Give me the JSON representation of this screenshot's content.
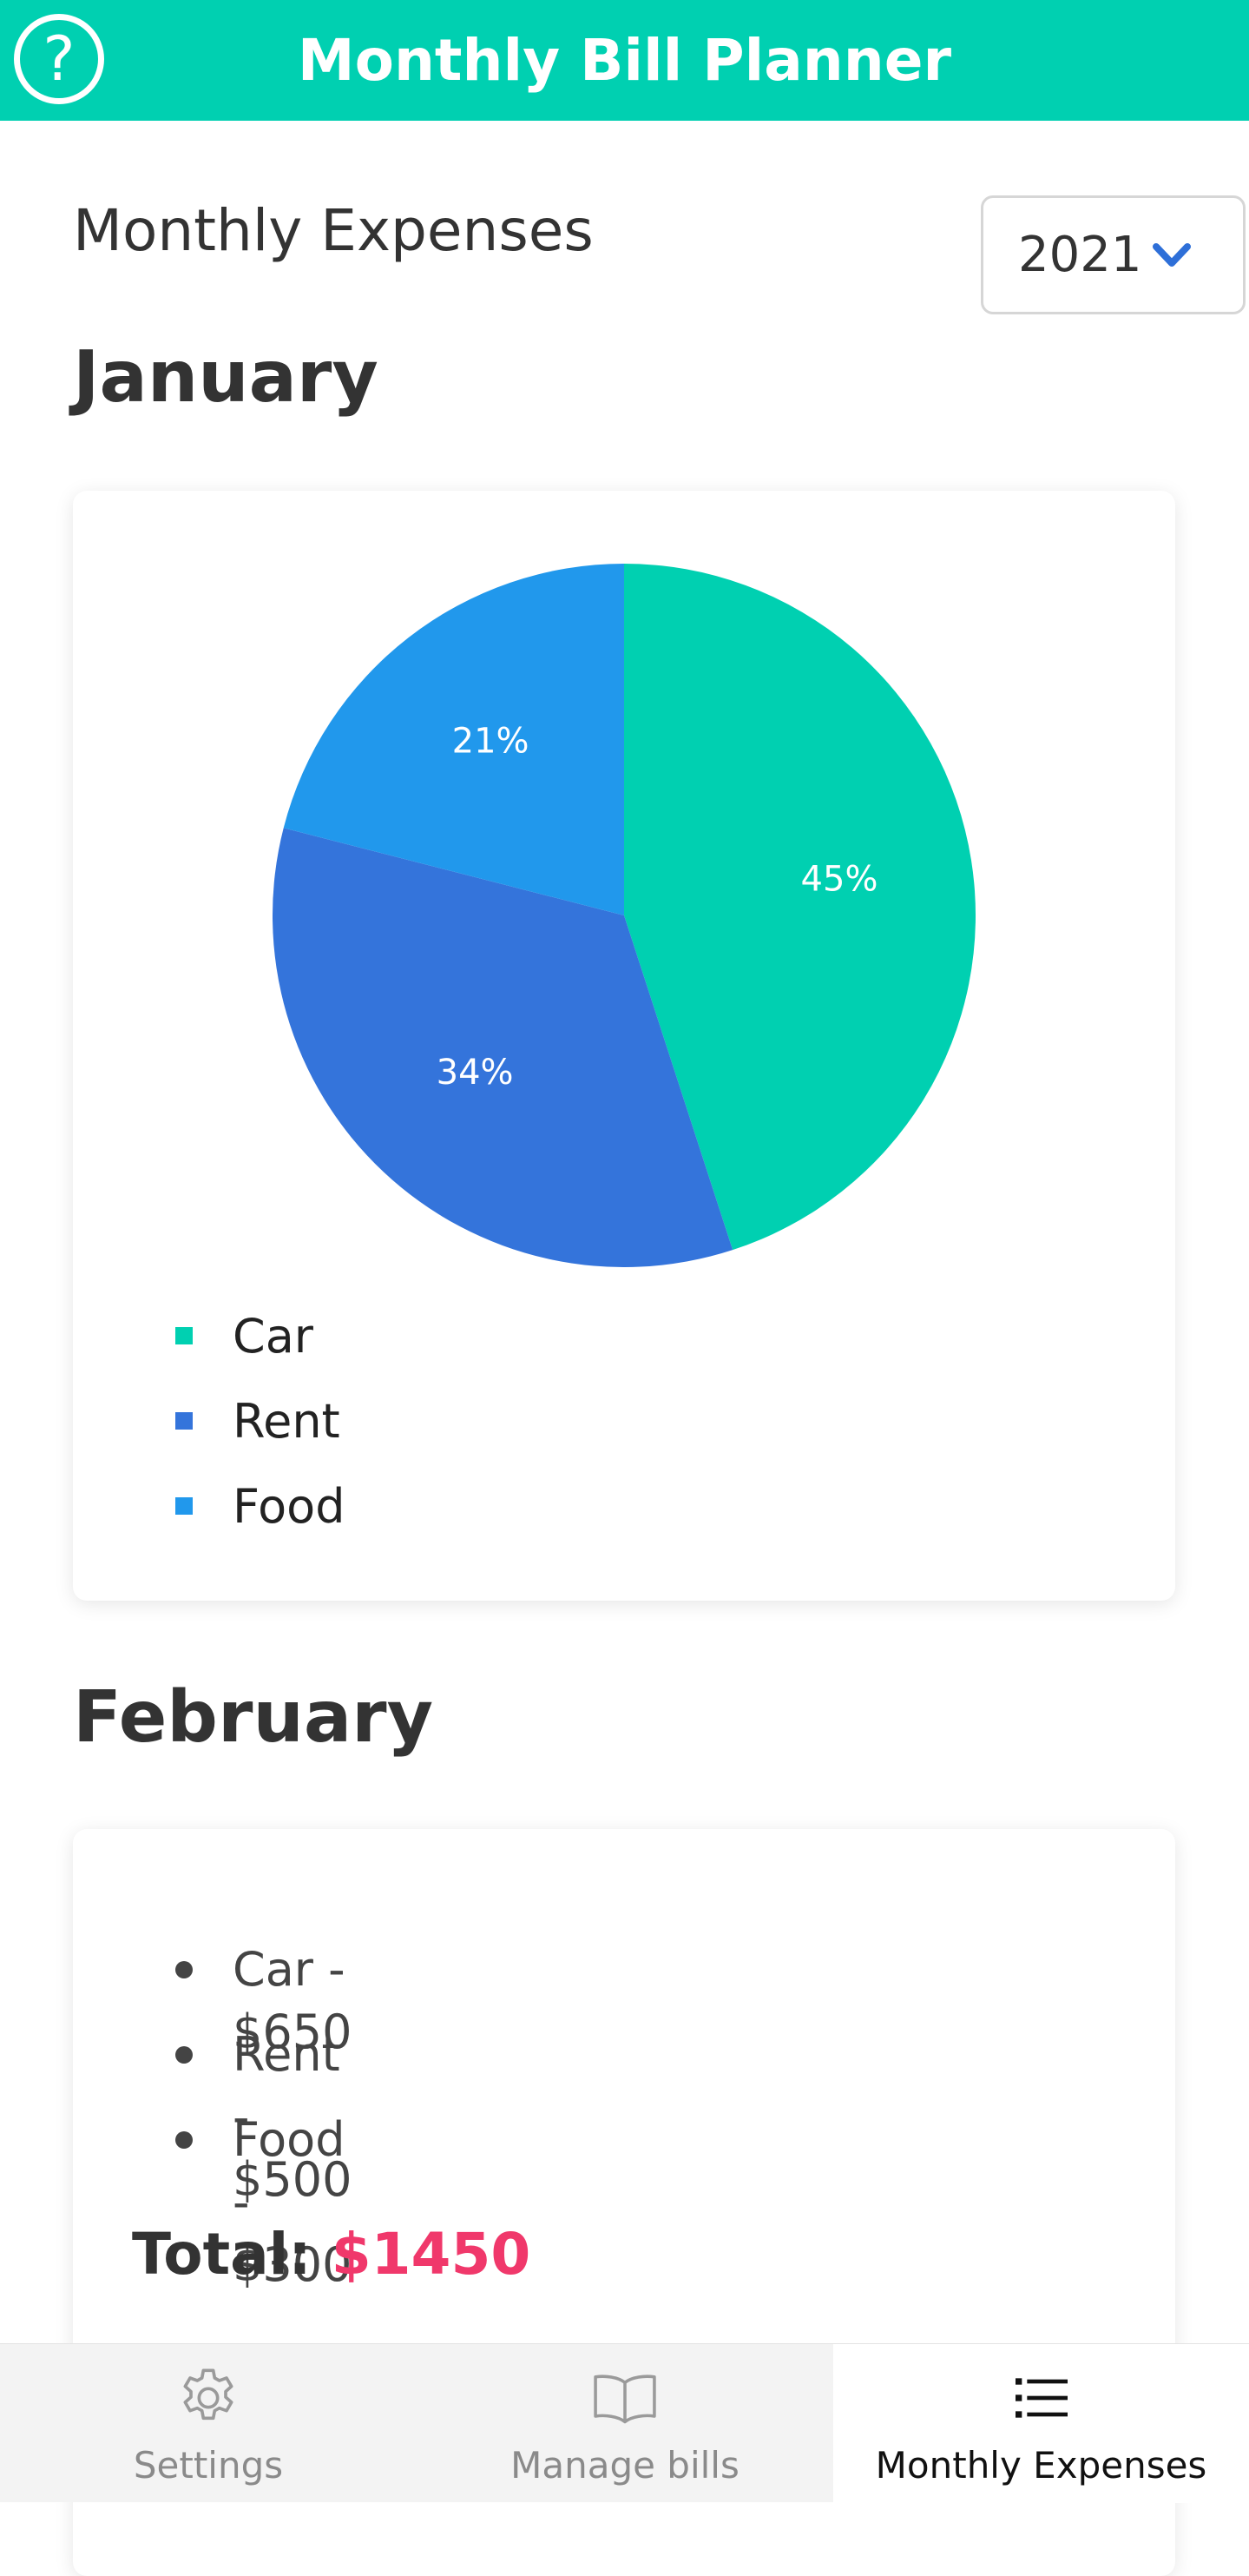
{
  "header": {
    "title": "Monthly Bill Planner",
    "help_icon": "question-circle-icon"
  },
  "colors": {
    "brand": "#00d0b1",
    "total_accent": "#f0386b"
  },
  "page": {
    "section_title": "Monthly Expenses",
    "year_select": {
      "value": "2021",
      "icon": "chevron-down-icon"
    }
  },
  "months": {
    "january": {
      "name": "January",
      "legend": [
        {
          "label": "Car",
          "color": "#00d0b1"
        },
        {
          "label": "Rent",
          "color": "#3474db"
        },
        {
          "label": "Food",
          "color": "#2198ec"
        }
      ]
    },
    "february": {
      "name": "February",
      "items": [
        "Car - $650",
        "Rent - $500",
        "Food - $300"
      ],
      "total_label": "Total:",
      "total_value": "$1450"
    }
  },
  "chart_data": {
    "type": "pie",
    "categories": [
      "Car",
      "Rent",
      "Food"
    ],
    "values": [
      45,
      34,
      21
    ],
    "labels": [
      "45%",
      "34%",
      "21%"
    ],
    "colors": [
      "#00d0b1",
      "#3474db",
      "#2198ec"
    ],
    "legend_position": "bottom-left"
  },
  "tabbar": {
    "tabs": [
      {
        "label": "Settings",
        "icon": "gear-icon"
      },
      {
        "label": "Manage bills",
        "icon": "book-icon"
      },
      {
        "label": "Monthly Expenses",
        "icon": "list-icon",
        "active": true
      }
    ]
  }
}
